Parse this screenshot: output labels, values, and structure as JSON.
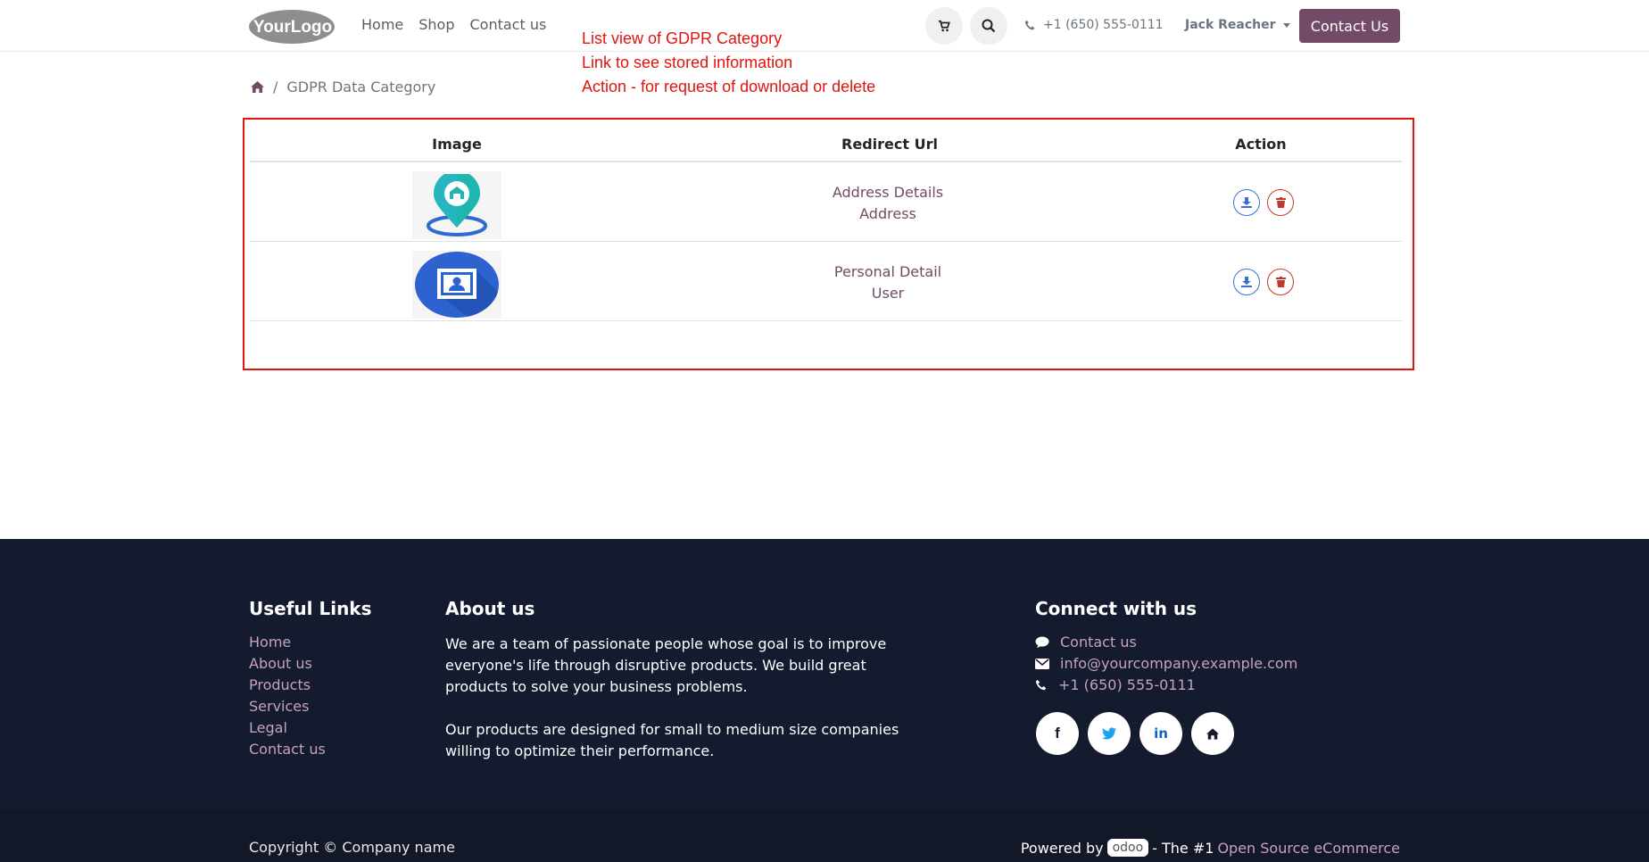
{
  "header": {
    "logo_text": "YourLogo",
    "nav": [
      "Home",
      "Shop",
      "Contact us"
    ],
    "phone": "+1 (650) 555-0111",
    "user": "Jack Reacher",
    "contact_button": "Contact Us"
  },
  "annotations": [
    "List view of GDPR Category",
    "Link to see stored information",
    "Action - for request of download or delete"
  ],
  "breadcrumb": {
    "current": "GDPR Data Category"
  },
  "table": {
    "headers": [
      "Image",
      "Redirect Url",
      "Action"
    ],
    "rows": [
      {
        "image_icon": "location-pin-icon",
        "line1": "Address Details",
        "line2": "Address"
      },
      {
        "image_icon": "user-card-icon",
        "line1": "Personal Detail",
        "line2": "User"
      }
    ]
  },
  "footer": {
    "useful_links_title": "Useful Links",
    "useful_links": [
      "Home",
      "About us",
      "Products",
      "Services",
      "Legal",
      "Contact us"
    ],
    "about_title": "About us",
    "about_p1": "We are a team of passionate people whose goal is to improve everyone's life through disruptive products. We build great products to solve your business problems.",
    "about_p2": "Our products are designed for small to medium size companies willing to optimize their performance.",
    "connect_title": "Connect with us",
    "connect_contact": "Contact us",
    "connect_email": "info@yourcompany.example.com",
    "connect_phone": "+1 (650) 555-0111",
    "socials": [
      "f",
      "t",
      "in",
      "home"
    ],
    "copyright": "Copyright © Company name",
    "powered_prefix": "Powered by",
    "powered_brand": "odoo",
    "powered_mid": "- The #1",
    "powered_link": "Open Source eCommerce"
  },
  "colors": {
    "brand": "#714b67",
    "annotation": "#e0140f",
    "footer_bg": "#151b2e",
    "link": "#c7a2bb"
  }
}
